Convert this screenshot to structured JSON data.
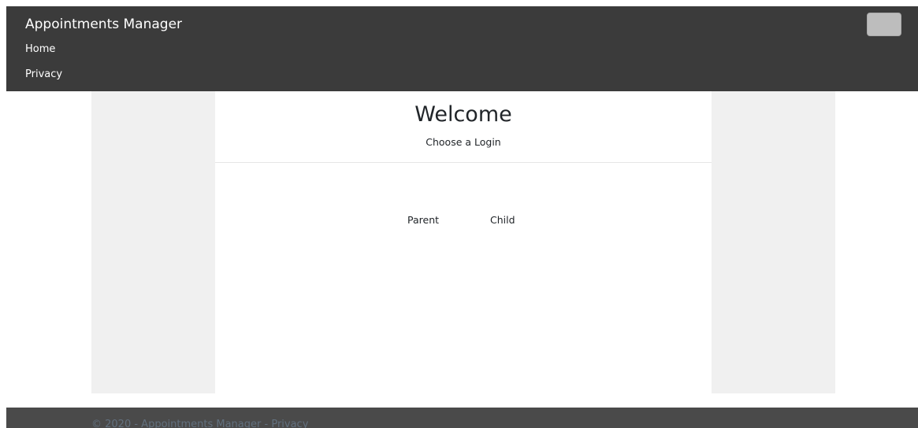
{
  "navbar": {
    "brand": "Appointments Manager",
    "links": [
      "Home",
      "Privacy"
    ]
  },
  "main": {
    "title": "Welcome",
    "subtitle": "Choose a Login",
    "login_options": [
      "Parent",
      "Child"
    ]
  },
  "footer": {
    "copyright": "© 2020 - Appointments Manager -",
    "privacy_link": "Privacy"
  },
  "colors": {
    "navbar_bg": "#3b3b3b",
    "sidebar_bg": "#f0f0f0",
    "footer_bg": "#4a4a4a",
    "footer_text": "#62707e"
  }
}
